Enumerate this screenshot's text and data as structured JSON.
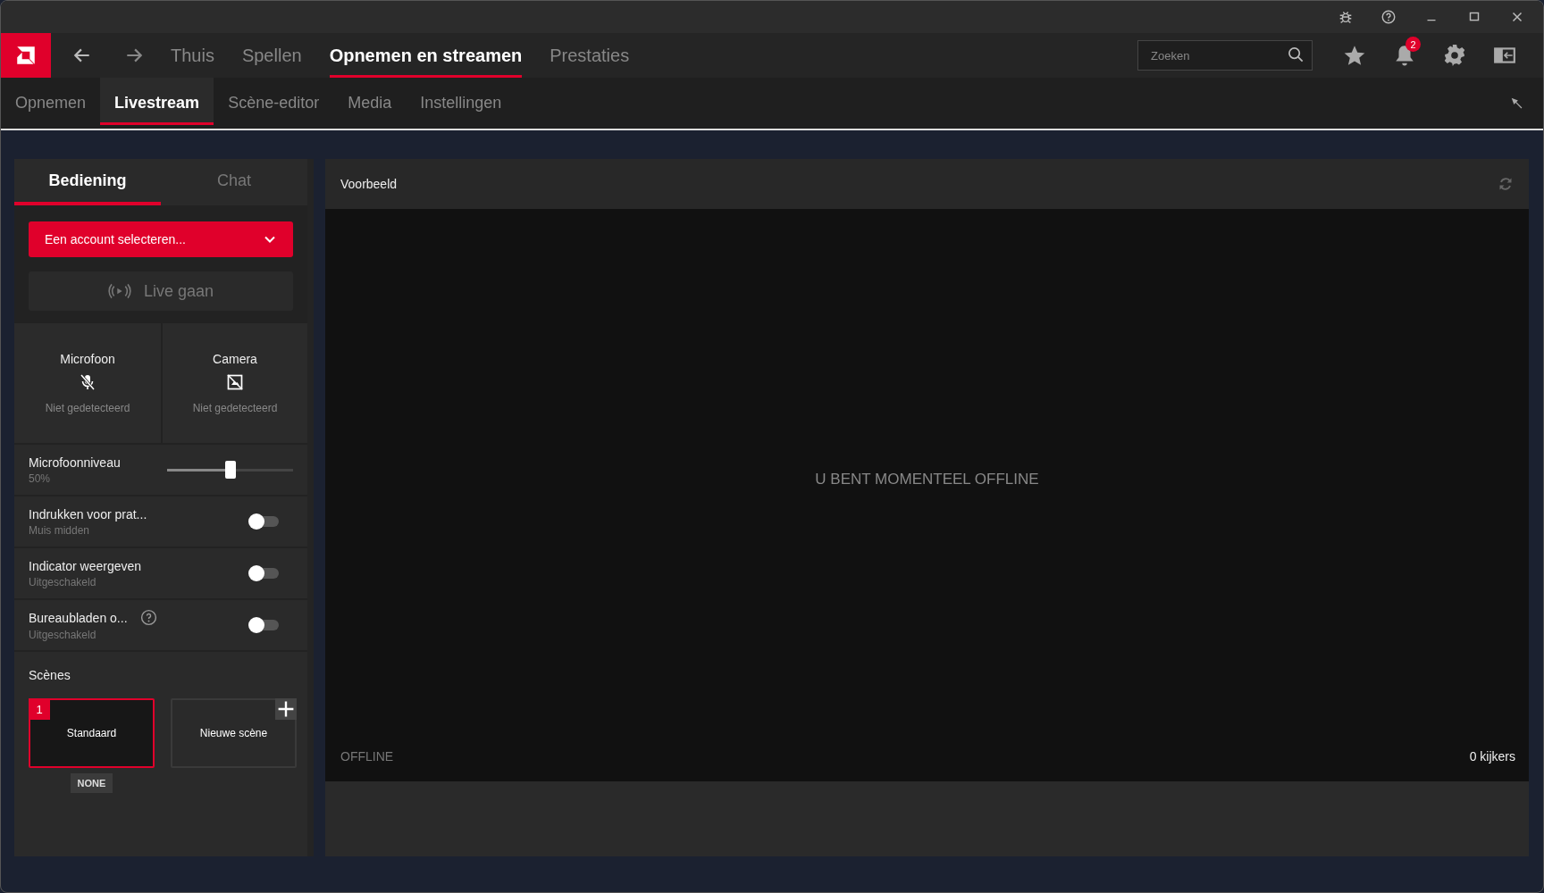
{
  "nav": {
    "items": [
      {
        "label": "Thuis",
        "selected": false
      },
      {
        "label": "Spellen",
        "selected": false
      },
      {
        "label": "Opnemen en streamen",
        "selected": true
      },
      {
        "label": "Prestaties",
        "selected": false
      }
    ]
  },
  "search": {
    "placeholder": "Zoeken"
  },
  "notifications": {
    "badge": "2"
  },
  "subtabs": [
    {
      "label": "Opnemen",
      "selected": false
    },
    {
      "label": "Livestream",
      "selected": true
    },
    {
      "label": "Scène-editor",
      "selected": false
    },
    {
      "label": "Media",
      "selected": false
    },
    {
      "label": "Instellingen",
      "selected": false
    }
  ],
  "left_panel": {
    "tabs": [
      {
        "label": "Bediening",
        "selected": true
      },
      {
        "label": "Chat",
        "selected": false
      }
    ],
    "account_select": {
      "value": "Een account selecteren..."
    },
    "go_live": {
      "label": "Live gaan",
      "disabled": true
    },
    "devices": [
      {
        "kind": "mic",
        "name": "Microfoon",
        "status": "Niet gedetecteerd"
      },
      {
        "kind": "camera",
        "name": "Camera",
        "status": "Niet gedetecteerd"
      }
    ],
    "settings": [
      {
        "kind": "slider",
        "label": "Microfoonniveau",
        "sub": "50%",
        "level": 0.5
      },
      {
        "kind": "toggle",
        "label": "Indrukken voor prat...",
        "sub": "Muis midden",
        "on": false,
        "help": false
      },
      {
        "kind": "toggle",
        "label": "Indicator weergeven",
        "sub": "Uitgeschakeld",
        "on": false,
        "help": false
      },
      {
        "kind": "toggle",
        "label": "Bureaubladen o...",
        "sub": "Uitgeschakeld",
        "on": false,
        "help": true
      }
    ],
    "scenes": {
      "title": "Scènes",
      "items": [
        {
          "kind": "scene",
          "number": "1",
          "name": "Standaard",
          "tag": "NONE",
          "selected": true
        },
        {
          "kind": "new",
          "name": "Nieuwe scène",
          "selected": false
        }
      ]
    }
  },
  "preview": {
    "title": "Voorbeeld",
    "message": "U BENT MOMENTEEL OFFLINE",
    "status": "OFFLINE",
    "viewers": "0 kijkers"
  }
}
